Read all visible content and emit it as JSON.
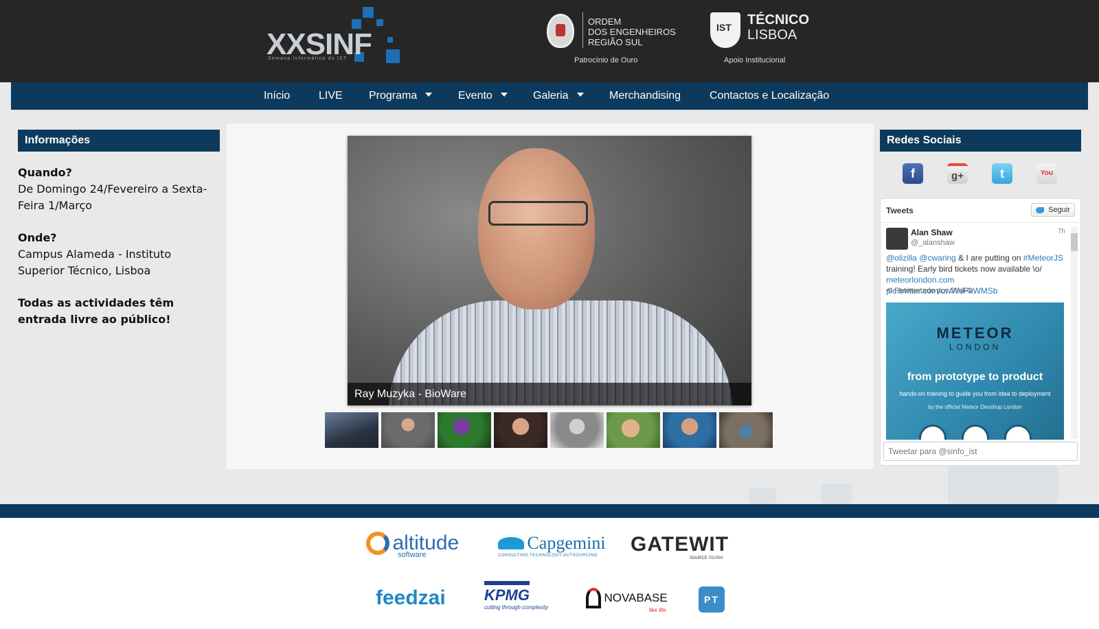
{
  "header": {
    "logo_text": "XXSINF",
    "logo_sub": "Semana Informática do IST",
    "sponsor_oe_lines": [
      "ORDEM",
      "DOS ENGENHEIROS",
      "REGIÃO SUL"
    ],
    "sponsor_oe_caption": "Patrocínio de Ouro",
    "sponsor_ist_line1": "TÉCNICO",
    "sponsor_ist_line2": "LISBOA",
    "sponsor_ist_caption": "Apoio Institucional"
  },
  "nav": {
    "items": [
      {
        "label": "Início"
      },
      {
        "label": "LIVE"
      },
      {
        "label": "Programa",
        "dropdown": true
      },
      {
        "label": "Evento",
        "dropdown": true
      },
      {
        "label": "Galeria",
        "dropdown": true
      },
      {
        "label": "Merchandising"
      },
      {
        "label": "Contactos e Localização"
      }
    ]
  },
  "info": {
    "heading": "Informações",
    "when_q": "Quando?",
    "when_a": "De Domingo 24/Fevereiro a Sexta-Feira 1/Março",
    "where_q": "Onde?",
    "where_a": "Campus Alameda - Instituto Superior Técnico, Lisboa",
    "note": "Todas as actividades têm entrada livre ao público!"
  },
  "slider": {
    "caption": "Ray Muzyka - BioWare",
    "thumb_count": 8
  },
  "social": {
    "heading": "Redes Sociais",
    "icons": [
      "facebook-icon",
      "google-plus-icon",
      "twitter-icon",
      "youtube-icon"
    ]
  },
  "tweets": {
    "title": "Tweets",
    "follow_label": "Seguir",
    "author_name": "Alan Shaw",
    "author_handle": "@_alanshaw",
    "time": "7h",
    "text_mention1": "@olizilla",
    "text_mention2": "@cwaring",
    "text_mid": " & I are putting on ",
    "text_hashtag": "#MeteorJS",
    "text_rest": " training! Early bird tickets now available \\o/",
    "text_link1": "meteorlondon.com",
    "text_link2": "pic.twitter.com/uwWoPkWMSb",
    "retweet": "Retweetado por SINFO",
    "card_title": "METEOR",
    "card_sub": "LONDON",
    "card_headline": "from prototype to product",
    "card_tagline": "hands-on training to guide you from idea to deployment",
    "card_byline": "by the official Meteor Devshop London",
    "input_placeholder": "Tweetar para @sinfo_ist"
  },
  "sponsors": {
    "altitude": "altitude",
    "altitude_sub": "software",
    "capgemini": "Capgemini",
    "capgemini_sub": "CONSULTING.TECHNOLOGY.OUTSOURCING",
    "gatewit": "GATEWIT",
    "gatewit_sub": "SOURCE-TO-PAY",
    "feedzai": "feedzai",
    "kpmg": "KPMG",
    "kpmg_sub": "cutting through complexity",
    "novabase": "NOVABASE",
    "novabase_sub": "like life",
    "pt": "PT"
  },
  "colors": {
    "navy": "#0d3a5c",
    "topbar": "#262626",
    "link": "#2a7ab5"
  }
}
